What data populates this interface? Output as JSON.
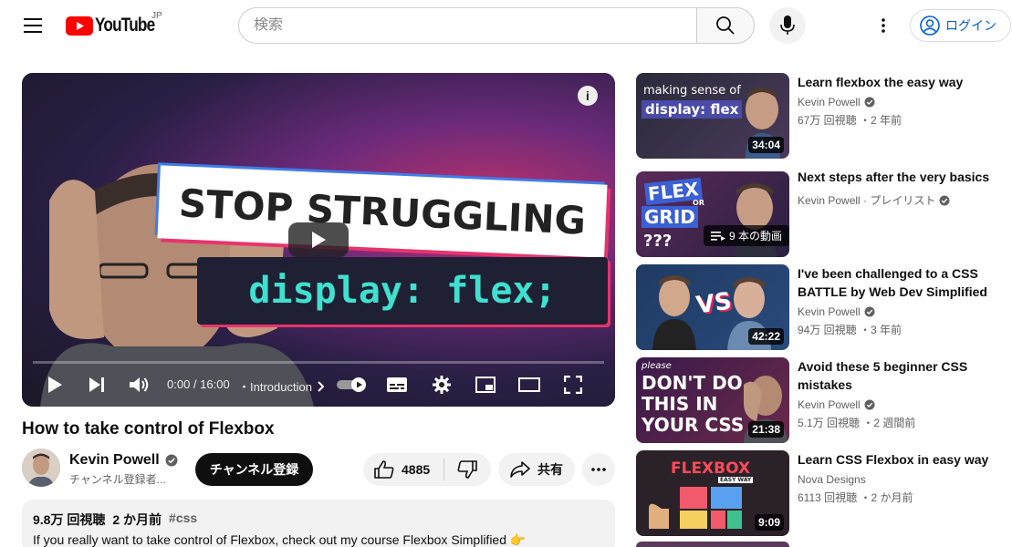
{
  "header": {
    "logo_text": "YouTube",
    "region": "JP",
    "search_placeholder": "検索",
    "login_label": "ログイン"
  },
  "player": {
    "thumbnail_line1": "STOP STRUGGLING",
    "thumbnail_line2": "display: flex;",
    "time": "0:00 / 16:00",
    "chapter": "・Introduction",
    "progress_fraction": 0
  },
  "video": {
    "title": "How to take control of Flexbox",
    "channel_name": "Kevin Powell",
    "subscribers": "チャンネル登録者...",
    "subscribe_label": "チャンネル登録",
    "likes": "4885",
    "share_label": "共有"
  },
  "description": {
    "views": "9.8万 回視聴",
    "date": "2 か月前",
    "tag": "#css",
    "text": "If you really want to take control of Flexbox, check out my course Flexbox Simplified 👉"
  },
  "related": [
    {
      "title": "Learn flexbox the easy way",
      "channel": "Kevin Powell",
      "stats": "67万 回視聴 ・2 年前",
      "duration": "34:04",
      "thumb_line1": "making sense of",
      "thumb_line2": "display: flex"
    },
    {
      "title": "Next steps after the very basics",
      "channel": "Kevin Powell · プレイリスト",
      "playlist_count": "9 本の動画",
      "thumb_line1": "FLEX",
      "thumb_line2": "OR",
      "thumb_line3": "GRID",
      "thumb_line4": "???"
    },
    {
      "title": "I've been challenged to a CSS BATTLE by Web Dev Simplified",
      "channel": "Kevin Powell",
      "stats": "94万 回視聴 ・3 年前",
      "duration": "42:22",
      "thumb_line1": "VS"
    },
    {
      "title": "Avoid these 5 beginner CSS mistakes",
      "channel": "Kevin Powell",
      "stats": "5.1万 回視聴 ・2 週間前",
      "duration": "21:38",
      "thumb_line0": "please",
      "thumb_line1": "DON'T DO",
      "thumb_line2": "THIS IN",
      "thumb_line3": "YOUR CSS"
    },
    {
      "title": "Learn CSS Flexbox in easy way",
      "channel": "Nova Designs",
      "stats": "6113 回視聴 ・2 か月前",
      "duration": "9:09",
      "thumb_line1": "FLEXBOX",
      "thumb_line2": "EASY WAY"
    }
  ]
}
